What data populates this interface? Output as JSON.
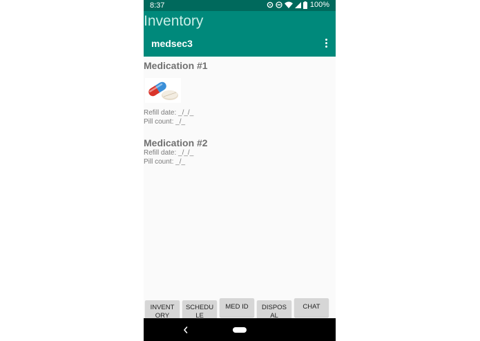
{
  "status_bar": {
    "time": "8:37",
    "battery": "100%",
    "icons": [
      "data-saver-icon",
      "do-not-disturb-icon",
      "wifi-icon",
      "signal-icon",
      "battery-icon"
    ]
  },
  "app_bar": {
    "title": "Inventory",
    "subtitle": "medsec3",
    "menu_icon": "overflow-menu-icon",
    "color": "#00897b"
  },
  "medications": [
    {
      "title": "Medication #1",
      "image": "pills-image",
      "refill_date": "Refill date: _/_/_",
      "pill_count": "Pill count: _/_"
    },
    {
      "title": "Medication #2",
      "refill_date": "Refill date: _/_/_",
      "pill_count": "Pill count: _/_"
    }
  ],
  "bottom_nav": {
    "buttons": [
      {
        "label": "INVENT\nORY"
      },
      {
        "label": "SCHEDU\nLE"
      },
      {
        "label": "MED ID"
      },
      {
        "label": "DISPOS\nAL"
      },
      {
        "label": "CHAT"
      }
    ]
  },
  "system_nav": {
    "back_icon": "back-icon",
    "home_icon": "home-icon"
  }
}
